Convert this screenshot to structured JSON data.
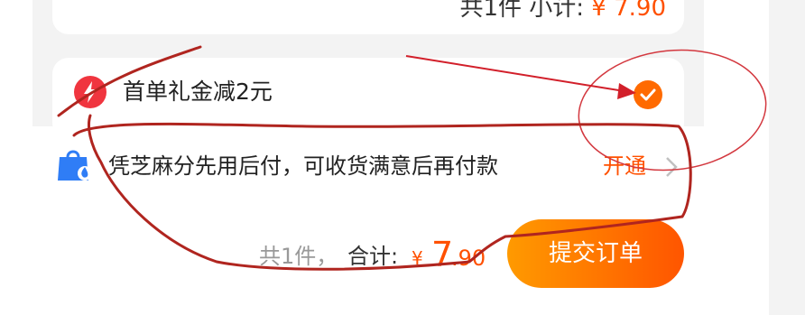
{
  "order_card_summary": {
    "count_text": "共1件 小计: ",
    "amount_text": "¥ 7.90"
  },
  "gift_row": {
    "icon": "lightning-bolt-icon",
    "label": "首单礼金减2元",
    "checked": true
  },
  "pay_later_row": {
    "icon": "shopping-bag-icon",
    "label": "凭芝麻分先用后付，可收货满意后再付款",
    "action_label": "开通",
    "action_icon": "chevron-right-icon"
  },
  "footer": {
    "count_label": "共1件，",
    "total_label": "合计:",
    "currency_symbol": "¥",
    "price_integer": "7",
    "price_decimal": ".90",
    "submit_label": "提交订单"
  },
  "colors": {
    "accent": "#ff5000",
    "annotation": "#b0251f",
    "bolt_bg": "#f0353f",
    "bag_blue": "#2f7df6"
  }
}
